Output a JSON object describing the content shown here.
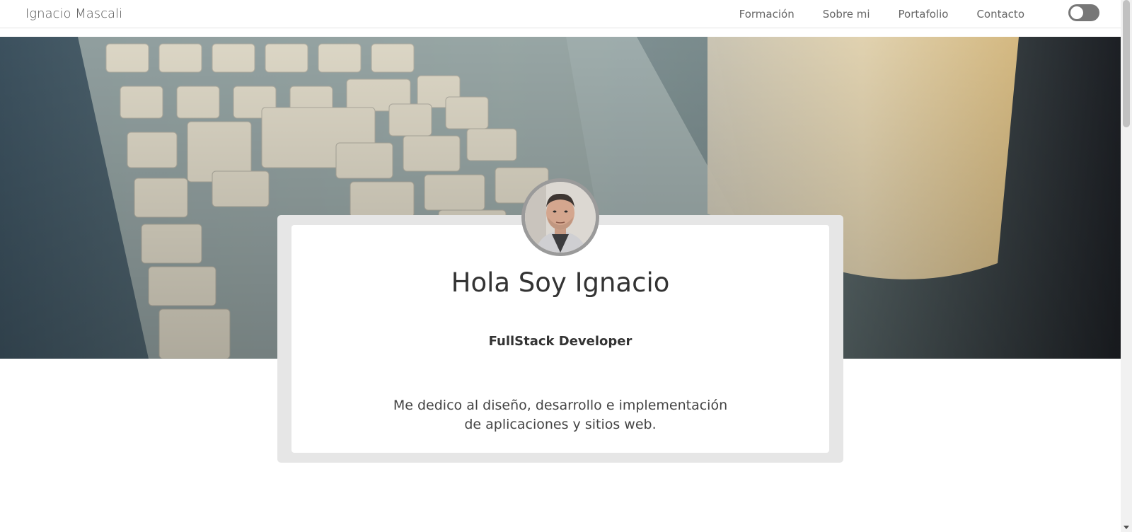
{
  "navbar": {
    "brand": "Ignacio Mascali",
    "links": [
      "Formación",
      "Sobre mi",
      "Portafolio",
      "Contacto"
    ],
    "theme_toggle": "off"
  },
  "hero": {
    "image": "keyboard-and-mug-photo"
  },
  "card": {
    "title": "Hola Soy Ignacio",
    "subtitle": "FullStack Developer",
    "description": "Me dedico al diseño, desarrollo e implementación de aplicaciones y sitios web.",
    "avatar": "profile-photo"
  },
  "colors": {
    "nav_text": "#666666",
    "card_border": "#e6e6e6",
    "toggle": "#777777"
  }
}
